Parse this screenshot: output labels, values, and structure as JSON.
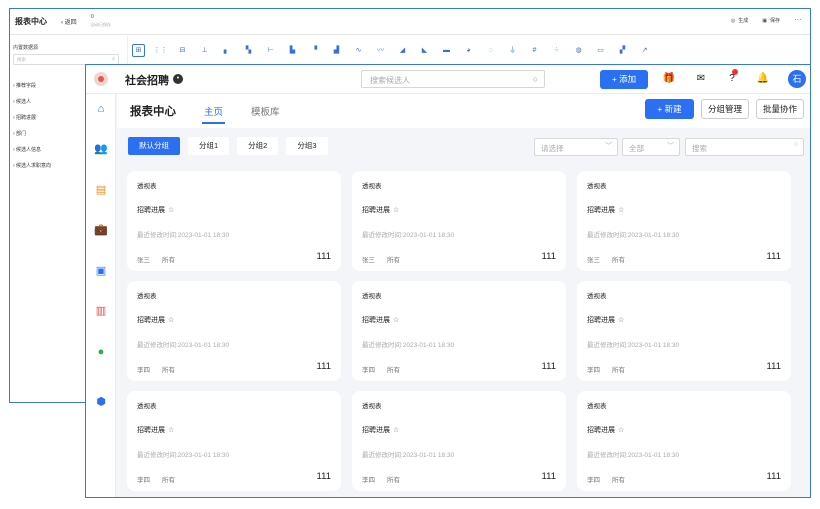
{
  "back_window": {
    "title": "报表中心",
    "back_label": "‹ 返回",
    "version": "0",
    "saved_status": "自动已保存",
    "actions": [
      {
        "label": "生成",
        "icon": "target-icon"
      },
      {
        "label": "保存",
        "icon": "save-icon"
      }
    ],
    "more": "···",
    "sidebar": {
      "section_label": "内置数据源",
      "search_placeholder": "搜索",
      "items": [
        "› 推荐字段",
        "› 候选人",
        "› 招聘进展",
        "› 部门",
        "› 候选人信息",
        "› 候选人求职意向"
      ]
    },
    "toolbar_icons": [
      "table-icon",
      "pivot-table-icon",
      "cross-table-icon",
      "bar-chart-icon",
      "stacked-bar-icon",
      "grouped-bar-icon",
      "horizontal-bar-icon",
      "percent-bar-icon",
      "column-icon",
      "stacked-column-icon",
      "line-icon",
      "area-line-icon",
      "area-icon",
      "stacked-area-icon",
      "heat-icon",
      "pie-icon",
      "donut-icon",
      "funnel-icon",
      "number-icon",
      "scatter-icon",
      "gauge-icon",
      "map-icon",
      "combo-icon",
      "trend-icon"
    ]
  },
  "app": {
    "brand": "社会招聘",
    "search_placeholder": "搜索候选人",
    "add_label": "+ 添加",
    "avatar_text": "石",
    "header_icons": [
      "gift-icon",
      "mail-icon",
      "help-icon",
      "bell-icon"
    ]
  },
  "left_nav": [
    "home-icon",
    "people-icon",
    "calendar-icon",
    "briefcase-icon",
    "contacts-icon",
    "report-chart-icon",
    "wechat-icon",
    "settings-hex-icon"
  ],
  "page": {
    "title": "报表中心",
    "tabs": [
      {
        "label": "主页",
        "active": true
      },
      {
        "label": "模板库",
        "active": false
      }
    ],
    "new_label": "+ 新建",
    "group_manage_label": "分组管理",
    "batch_label": "批量协作"
  },
  "groups": [
    {
      "label": "默认分组",
      "active": true
    },
    {
      "label": "分组1",
      "active": false
    },
    {
      "label": "分组2",
      "active": false
    },
    {
      "label": "分组3",
      "active": false
    }
  ],
  "filters": {
    "select_placeholder": "请选择",
    "all_placeholder": "全部",
    "search_placeholder": "搜索"
  },
  "cards": [
    {
      "type": "透视表",
      "name": "招聘进展",
      "time": "最近修改时间:2023-01-01 18:30",
      "owner": "张三",
      "scope": "所有",
      "count": "111"
    },
    {
      "type": "透视表",
      "name": "招聘进展",
      "time": "最近修改时间:2023-01-01 18:30",
      "owner": "张三",
      "scope": "所有",
      "count": "111"
    },
    {
      "type": "透视表",
      "name": "招聘进展",
      "time": "最近修改时间:2023-01-01 18:30",
      "owner": "张三",
      "scope": "所有",
      "count": "111"
    },
    {
      "type": "透视表",
      "name": "招聘进展",
      "time": "最近修改时间:2023-01-01 18:30",
      "owner": "李四",
      "scope": "所有",
      "count": "111"
    },
    {
      "type": "透视表",
      "name": "招聘进展",
      "time": "最近修改时间:2023-01-01 18:30",
      "owner": "李四",
      "scope": "所有",
      "count": "111"
    },
    {
      "type": "透视表",
      "name": "招聘进展",
      "time": "最近修改时间:2023-01-01 18:30",
      "owner": "李四",
      "scope": "所有",
      "count": "111"
    },
    {
      "type": "透视表",
      "name": "招聘进展",
      "time": "最近修改时间:2023-01-01 18:30",
      "owner": "李四",
      "scope": "所有",
      "count": "111"
    },
    {
      "type": "透视表",
      "name": "招聘进展",
      "time": "最近修改时间:2023-01-01 18:30",
      "owner": "李四",
      "scope": "所有",
      "count": "111"
    },
    {
      "type": "透视表",
      "name": "招聘进展",
      "time": "最近修改时间:2023-01-01 18:30",
      "owner": "李四",
      "scope": "所有",
      "count": "111"
    }
  ],
  "colors": {
    "accent": "#2b6ff3",
    "border": "#3a78d8",
    "background": "#f4f5f8"
  }
}
